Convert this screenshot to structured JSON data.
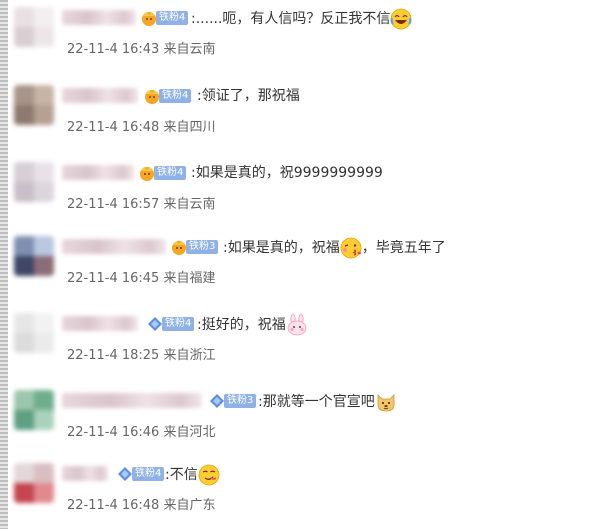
{
  "comments": [
    {
      "fan_level": "铁粉4",
      "text_part1": ":......呃，有人信吗？反正我不信",
      "emoji": "laughing-tears-emoji",
      "text_part2": "",
      "time": "22-11-4 16:43",
      "location": "来自云南"
    },
    {
      "fan_level": "铁粉4",
      "text_part1": ":领证了，那祝福",
      "emoji": "",
      "text_part2": "",
      "time": "22-11-4 16:48",
      "location": "来自四川"
    },
    {
      "fan_level": "铁粉4",
      "text_part1": ":如果是真的，祝9999999999",
      "emoji": "",
      "text_part2": "",
      "time": "22-11-4 16:57",
      "location": "来自云南"
    },
    {
      "fan_level": "铁粉3",
      "text_part1": ":如果是真的，祝福",
      "emoji": "kiss-emoji",
      "text_part2": "，毕竟五年了",
      "time": "22-11-4 16:45",
      "location": "来自福建"
    },
    {
      "fan_level": "铁粉4",
      "text_part1": ":挺好的，祝福",
      "emoji": "bunny-emoji",
      "text_part2": "",
      "time": "22-11-4 18:25",
      "location": "来自浙江"
    },
    {
      "fan_level": "铁粉3",
      "text_part1": ":那就等一个官宣吧",
      "emoji": "doge-emoji",
      "text_part2": "",
      "time": "22-11-4 16:46",
      "location": "来自河北"
    },
    {
      "fan_level": "铁粉4",
      "text_part1": ":不信",
      "emoji": "smirk-emoji",
      "text_part2": "",
      "time": "22-11-4 16:48",
      "location": "来自广东"
    }
  ],
  "colors": {
    "badge_blue": "#8fb1e6",
    "text": "#333333",
    "meta": "#666666"
  }
}
